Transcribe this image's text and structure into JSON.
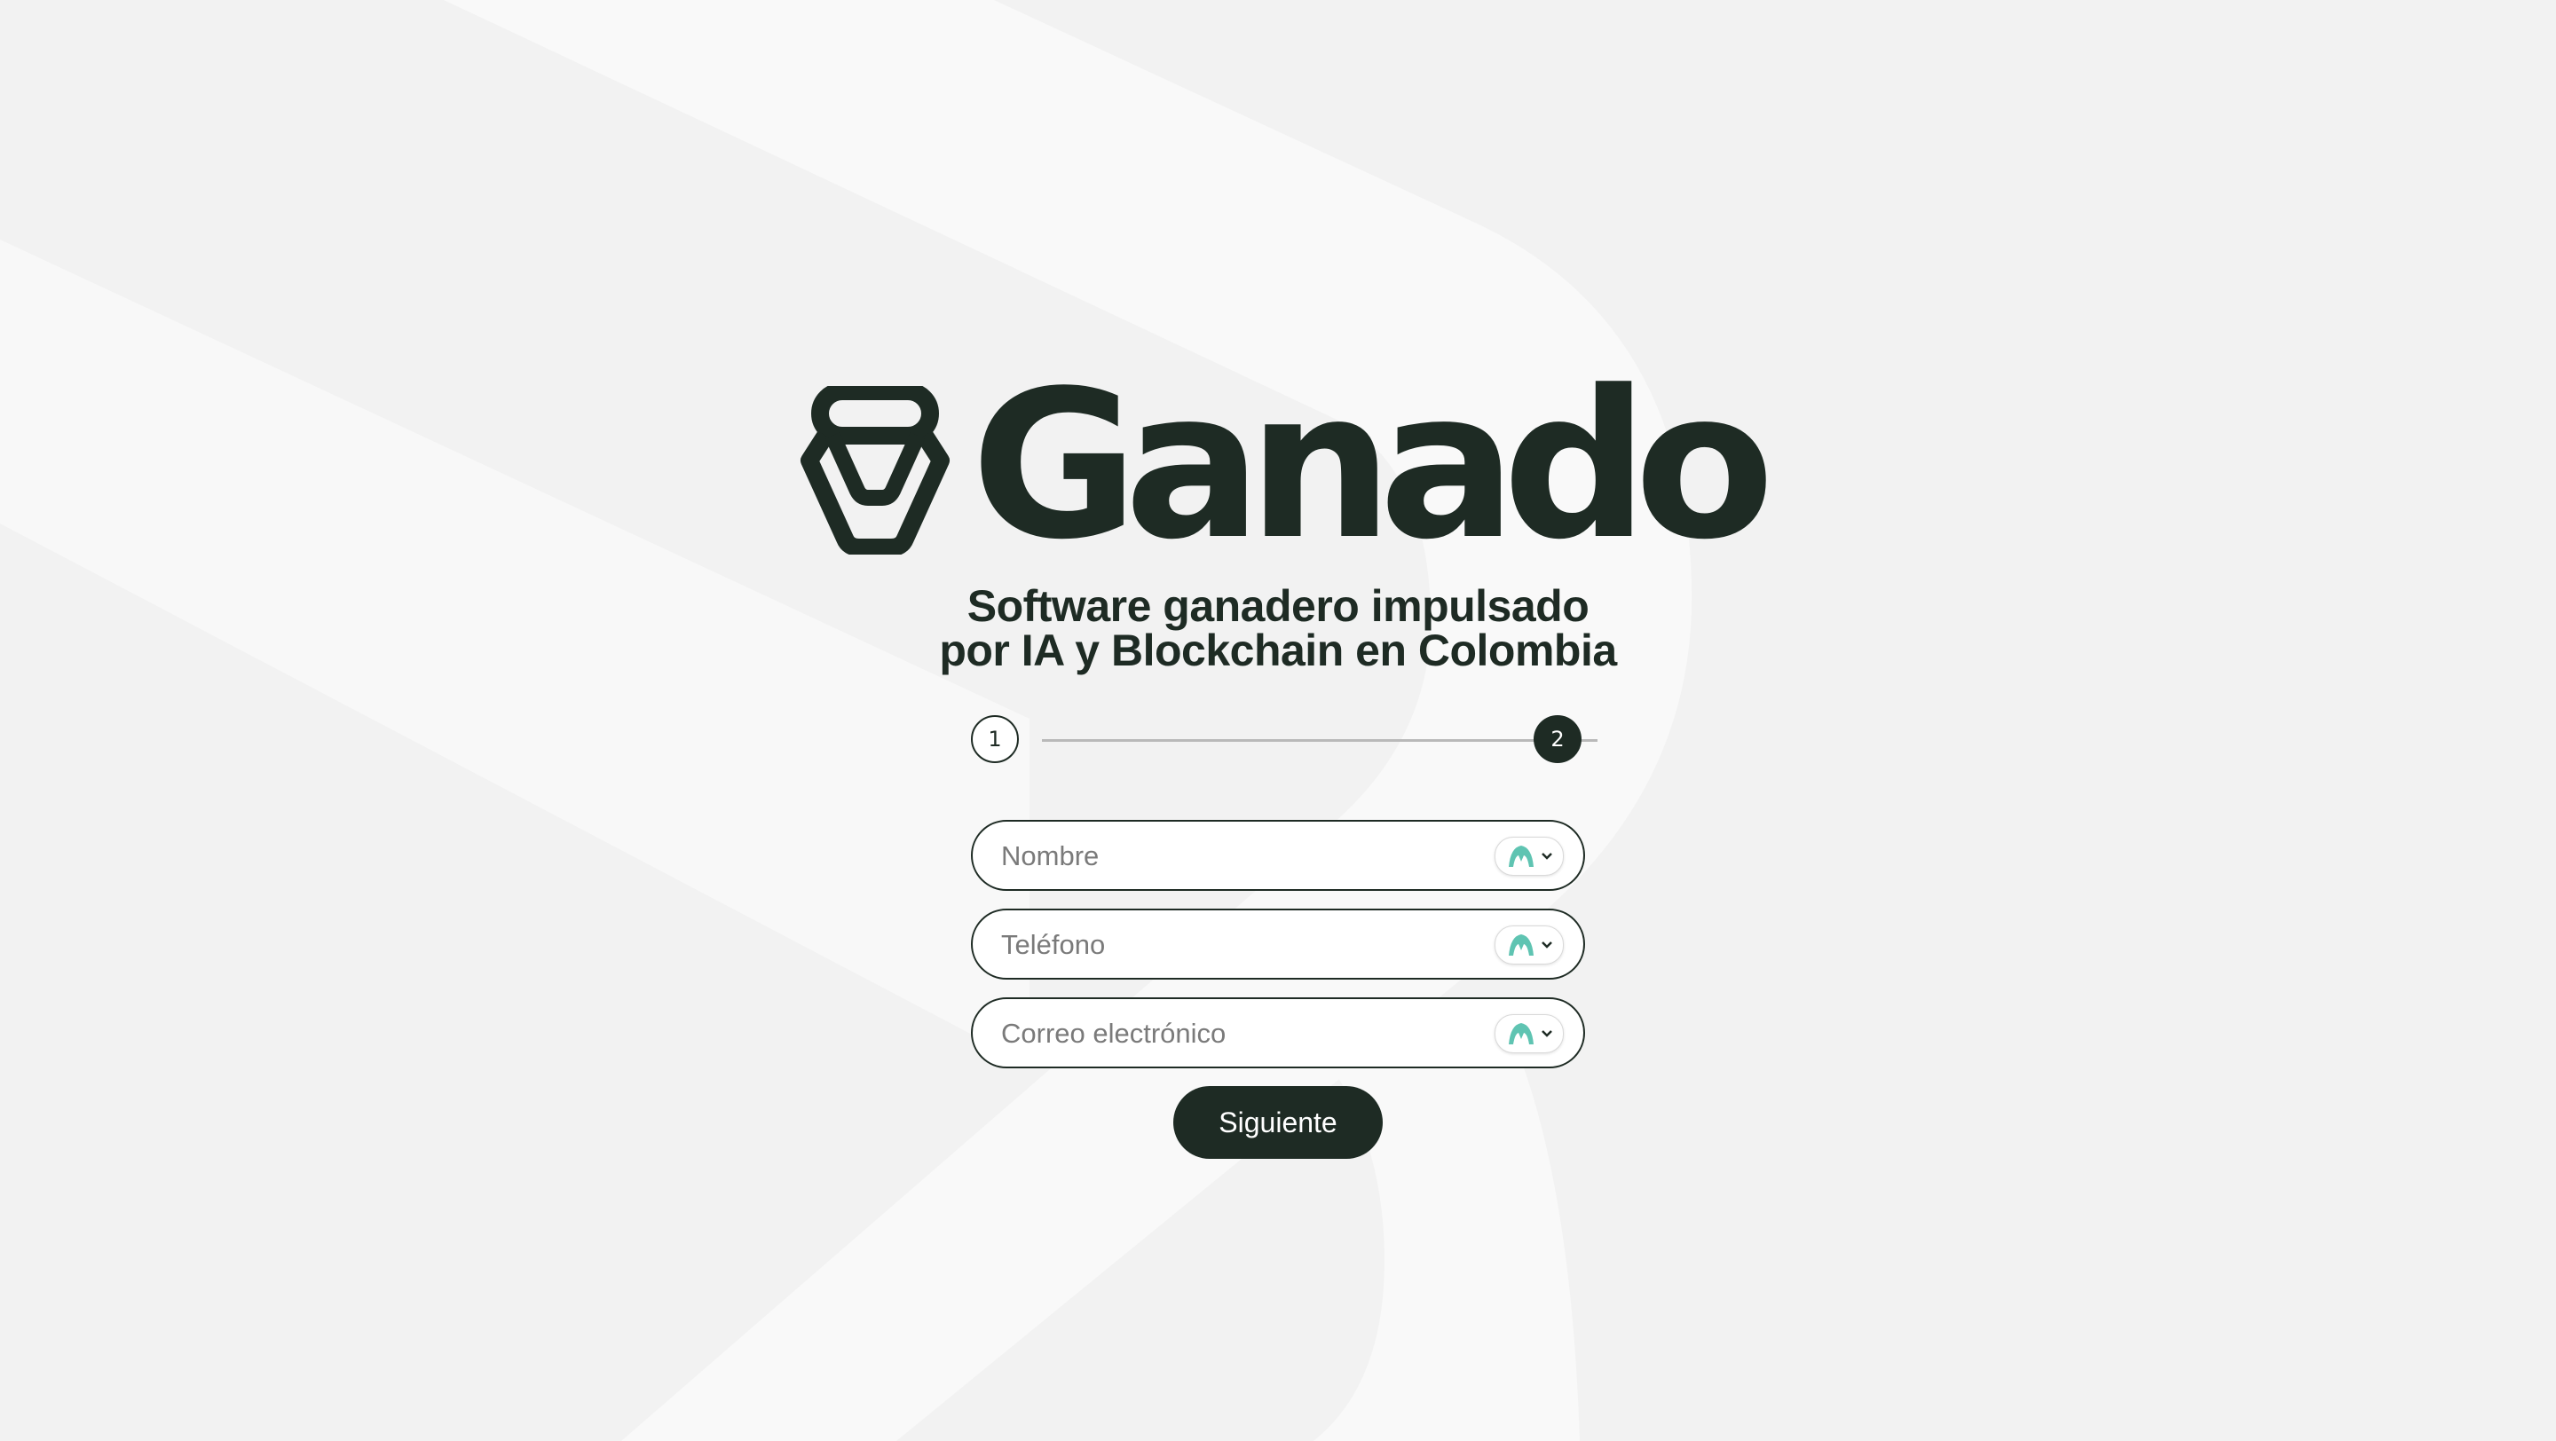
{
  "brand": {
    "name": "Ganado",
    "tagline_line1": "Software ganadero impulsado",
    "tagline_line2": "por IA y Blockchain en Colombia",
    "logo_icon": "bucket-logo-icon"
  },
  "stepper": {
    "steps": [
      "1",
      "2"
    ],
    "current_step": 2
  },
  "form": {
    "fields": [
      {
        "placeholder": "Nombre",
        "value": ""
      },
      {
        "placeholder": "Teléfono",
        "value": ""
      },
      {
        "placeholder": "Correo electrónico",
        "value": ""
      }
    ],
    "field_widget_icon": "password-manager-icon",
    "submit_label": "Siguiente"
  },
  "colors": {
    "brand_dark": "#1e2b24",
    "background": "#f2f2f2",
    "widget_accent": "#5fc4b2"
  }
}
